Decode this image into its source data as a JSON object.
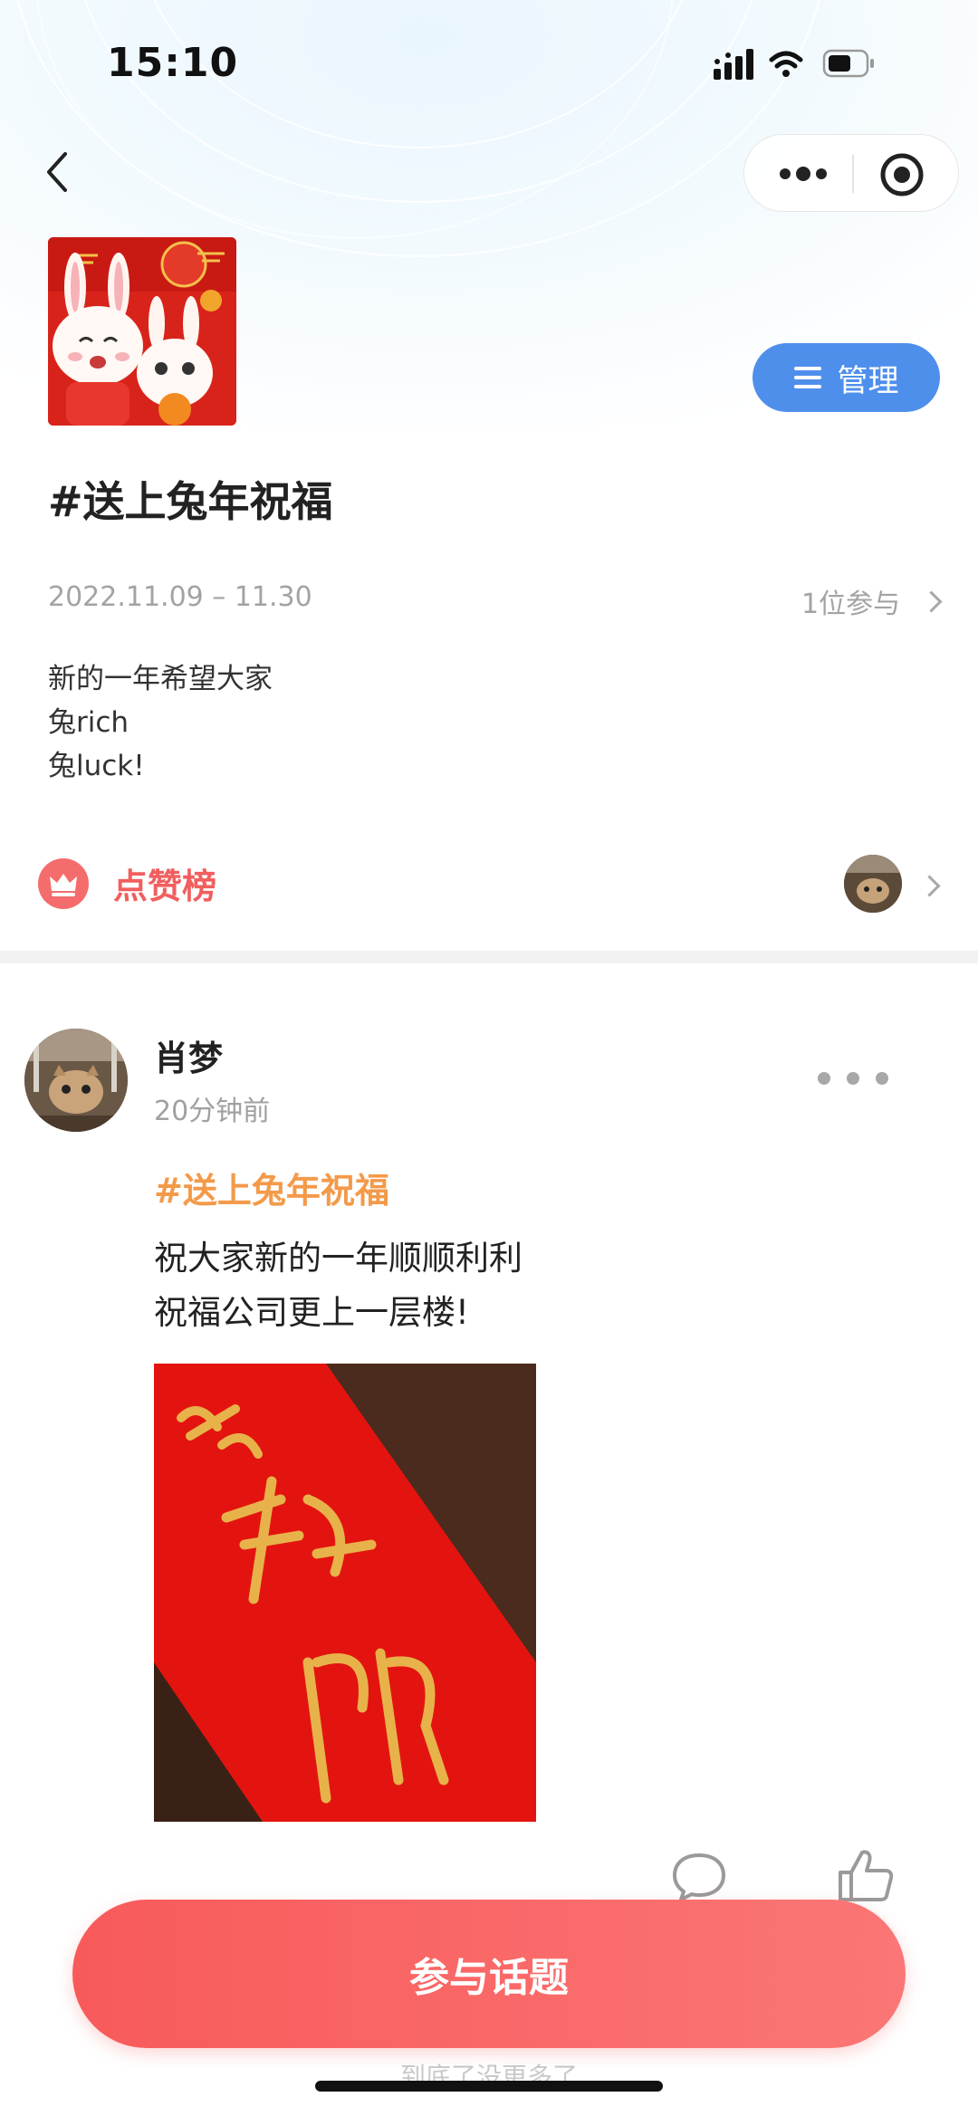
{
  "status_bar": {
    "time": "15:10"
  },
  "topic": {
    "title": "#送上兔年祝福",
    "date_range": "2022.11.09 – 11.30",
    "participants": "1位参与",
    "description": [
      "新的一年希望大家",
      "兔rich",
      "兔luck!"
    ],
    "manage_label": "管理"
  },
  "likes_board": {
    "label": "点赞榜"
  },
  "post": {
    "author": "肖梦",
    "time": "20分钟前",
    "tag": "#送上兔年祝福",
    "body": [
      "祝大家新的一年顺顺利利",
      "祝福公司更上一层楼!"
    ]
  },
  "join_button": {
    "label": "参与话题"
  },
  "footer_hint": "到底了没更多了",
  "colors": {
    "accent_blue": "#4f8fec",
    "accent_red": "#f85a5a",
    "tag_orange": "#f39a4a",
    "likes_red": "#f15e5e"
  },
  "icons": [
    "back-icon",
    "more-icon",
    "target-icon",
    "menu-icon",
    "crown-icon",
    "chevron-right-icon",
    "comment-icon",
    "like-icon"
  ]
}
